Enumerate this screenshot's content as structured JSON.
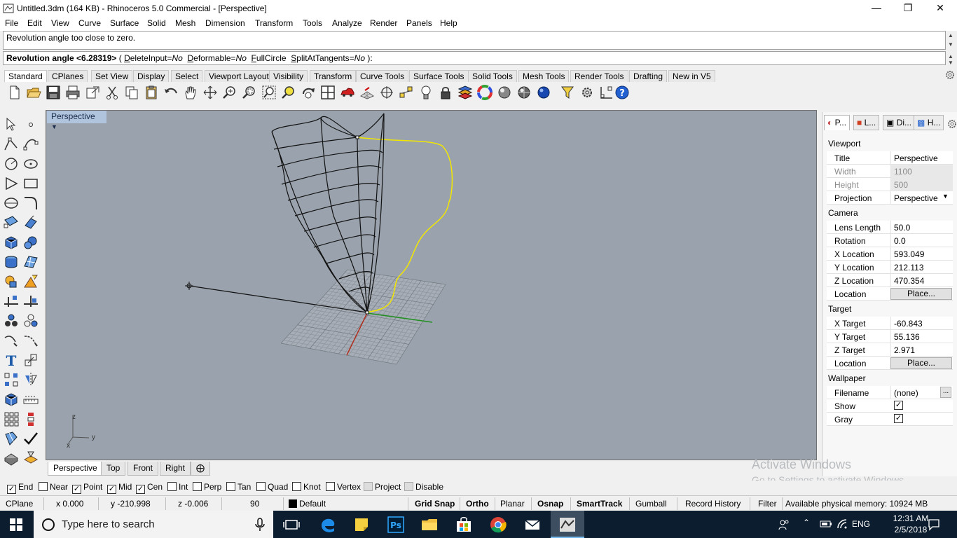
{
  "window": {
    "title": "Untitled.3dm (164 KB) - Rhinoceros 5.0 Commercial - [Perspective]",
    "minimize_icon": "minimize-icon",
    "restore_icon": "restore-icon",
    "close_icon": "close-icon"
  },
  "menubar": {
    "items": [
      "File",
      "Edit",
      "View",
      "Curve",
      "Surface",
      "Solid",
      "Mesh",
      "Dimension",
      "Transform",
      "Tools",
      "Analyze",
      "Render",
      "Panels",
      "Help"
    ]
  },
  "command": {
    "history": "Revolution angle too close to zero.",
    "prompt_bold": "Revolution angle <6.28319>",
    "prompt_open": " ( ",
    "opt1_key": "D",
    "opt1_rest": "eleteInput=",
    "opt1_val": "No",
    "opt2_key": "D",
    "opt2_rest": "eformable=",
    "opt2_val": "No",
    "opt3_key": "F",
    "opt3_rest": "ullCircle",
    "opt4_key": "S",
    "opt4_rest": "plitAtTangents=",
    "opt4_val": "No",
    "prompt_close": " ):"
  },
  "toolbar_tabs": [
    "Standard",
    "CPlanes",
    "Set View",
    "Display",
    "Select",
    "Viewport Layout",
    "Visibility",
    "Transform",
    "Curve Tools",
    "Surface Tools",
    "Solid Tools",
    "Mesh Tools",
    "Render Tools",
    "Drafting",
    "New in V5"
  ],
  "toolbar_icons": [
    "new-file-icon",
    "open-file-icon",
    "save-icon",
    "print-icon",
    "import-icon",
    "cut-icon",
    "copy-icon",
    "paste-icon",
    "undo-icon",
    "pan-icon",
    "rotate-view-icon",
    "zoom-icon",
    "zoom-window-icon",
    "zoom-extents-icon",
    "zoom-selected-icon",
    "rotate-icon",
    "four-views-icon",
    "car-icon",
    "grid-icon",
    "osnap-icon",
    "points-icon",
    "light-icon",
    "lock-icon",
    "layer-icon",
    "color-wheel-icon",
    "render-sphere-icon",
    "rendered-sphere-icon",
    "blue-sphere-icon",
    "filter-icon",
    "settings-icon",
    "dimension-icon",
    "help-icon"
  ],
  "left_tools": [
    "select-icon",
    "point-icon",
    "polyline-icon",
    "curve-point-icon",
    "circle-icon",
    "ellipse-icon",
    "polygon-icon",
    "rectangle-icon",
    "arc-icon",
    "fillet-curve-icon",
    "surface-icon",
    "extrude-icon",
    "box-icon",
    "sphere-icon",
    "cylinder-icon",
    "patch-icon",
    "boolean-icon",
    "explode-icon",
    "trim-icon",
    "split-icon",
    "group-icon",
    "ungroup-icon",
    "offset-icon",
    "blend-icon",
    "text-icon",
    "scale-icon",
    "array-icon",
    "mirror-icon",
    "mesh-icon",
    "dimension-icon",
    "array-grid-icon",
    "align-icon",
    "cage-icon",
    "check-icon",
    "analyze-icon",
    "render-icon"
  ],
  "viewport": {
    "label": "Perspective",
    "axis_x": "x",
    "axis_y": "y",
    "axis_z": "z"
  },
  "viewport_tabs": [
    "Perspective",
    "Top",
    "Front",
    "Right"
  ],
  "panel": {
    "tabs": [
      "P...",
      "L...",
      "Di...",
      "H..."
    ],
    "sections": {
      "viewport": "Viewport",
      "camera": "Camera",
      "target": "Target",
      "wallpaper": "Wallpaper"
    },
    "viewport_rows": [
      {
        "label": "Title",
        "value": "Perspective"
      },
      {
        "label": "Width",
        "value": "1100"
      },
      {
        "label": "Height",
        "value": "500"
      },
      {
        "label": "Projection",
        "value": "Perspective"
      }
    ],
    "camera_rows": [
      {
        "label": "Lens Length",
        "value": "50.0"
      },
      {
        "label": "Rotation",
        "value": "0.0"
      },
      {
        "label": "X Location",
        "value": "593.049"
      },
      {
        "label": "Y Location",
        "value": "212.113"
      },
      {
        "label": "Z Location",
        "value": "470.354"
      },
      {
        "label": "Location",
        "value": "Place..."
      }
    ],
    "target_rows": [
      {
        "label": "X Target",
        "value": "-60.843"
      },
      {
        "label": "Y Target",
        "value": "55.136"
      },
      {
        "label": "Z Target",
        "value": "2.971"
      },
      {
        "label": "Location",
        "value": "Place..."
      }
    ],
    "wallpaper_rows": [
      {
        "label": "Filename",
        "value": "(none)"
      },
      {
        "label": "Show",
        "value": "checked"
      },
      {
        "label": "Gray",
        "value": "checked"
      }
    ],
    "browse_label": "..."
  },
  "osnap": [
    {
      "label": "End",
      "checked": true
    },
    {
      "label": "Near",
      "checked": false
    },
    {
      "label": "Point",
      "checked": true
    },
    {
      "label": "Mid",
      "checked": true
    },
    {
      "label": "Cen",
      "checked": true
    },
    {
      "label": "Int",
      "checked": false
    },
    {
      "label": "Perp",
      "checked": false
    },
    {
      "label": "Tan",
      "checked": false
    },
    {
      "label": "Quad",
      "checked": false
    },
    {
      "label": "Knot",
      "checked": false
    },
    {
      "label": "Vertex",
      "checked": false
    },
    {
      "label": "Project",
      "checked": false
    },
    {
      "label": "Disable",
      "checked": false
    }
  ],
  "status": {
    "cplane": "CPlane",
    "x": "x 0.000",
    "y": "y -210.998",
    "z": "z -0.006",
    "angle": "90",
    "layer": "Default",
    "grid_snap": "Grid Snap",
    "ortho": "Ortho",
    "planar": "Planar",
    "osnap": "Osnap",
    "smarttrack": "SmartTrack",
    "gumball": "Gumball",
    "record_history": "Record History",
    "filter": "Filter",
    "memory": "Available physical memory: 10924 MB"
  },
  "watermark": {
    "line1": "Activate Windows",
    "line2": "Go to Settings to activate Windows."
  },
  "taskbar": {
    "search_placeholder": "Type here to search",
    "lang": "ENG",
    "time": "12:31 AM",
    "date": "2/5/2018"
  },
  "colors": {
    "viewport_bg": "#9aa3ad",
    "curve_yellow": "#f2e600",
    "x_axis": "#b03020",
    "y_axis": "#209020"
  }
}
